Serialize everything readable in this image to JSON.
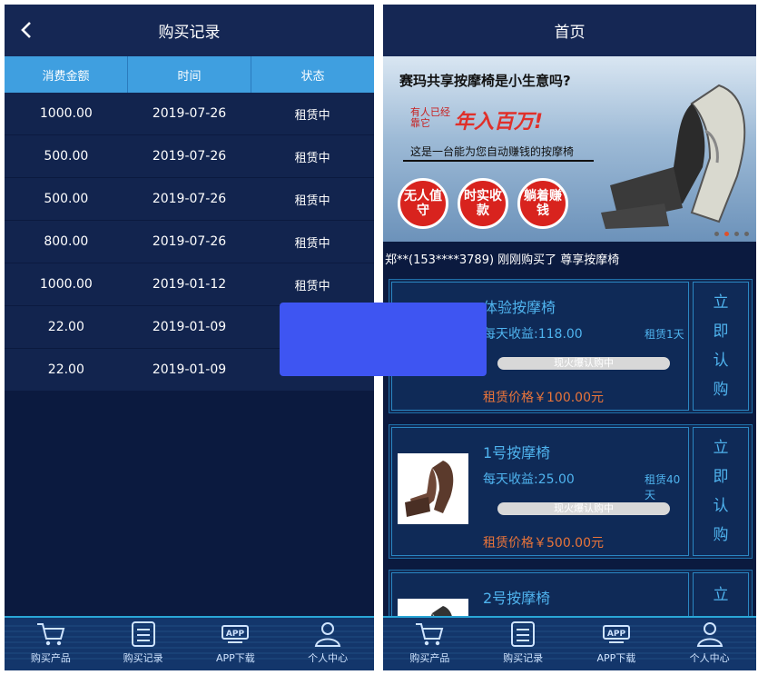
{
  "left": {
    "title": "购买记录",
    "columns": [
      "消费金额",
      "时间",
      "状态"
    ],
    "rows": [
      {
        "amount": "1000.00",
        "date": "2019-07-26",
        "status": "租赁中"
      },
      {
        "amount": "500.00",
        "date": "2019-07-26",
        "status": "租赁中"
      },
      {
        "amount": "500.00",
        "date": "2019-07-26",
        "status": "租赁中"
      },
      {
        "amount": "800.00",
        "date": "2019-07-26",
        "status": "租赁中"
      },
      {
        "amount": "1000.00",
        "date": "2019-01-12",
        "status": "租赁中"
      },
      {
        "amount": "22.00",
        "date": "2019-01-09",
        "status": ""
      },
      {
        "amount": "22.00",
        "date": "2019-01-09",
        "status": ""
      }
    ]
  },
  "right": {
    "title": "首页",
    "banner": {
      "headline": "赛玛共享按摩椅是小生意吗?",
      "red_small": "有人已经靠它",
      "red_big": "年入百万!",
      "sub": "这是一台能为您自动赚钱的按摩椅",
      "badges": [
        "无人值守",
        "时实收款",
        "躺着赚钱"
      ]
    },
    "notice": "郑**(153****3789) 刚刚购买了 尊享按摩椅",
    "products": [
      {
        "name": "体验按摩椅",
        "income": "每天收益:118.00",
        "days": "租赁1天",
        "bar": "现火爆认购中",
        "price": "租赁价格￥100.00元",
        "buy": [
          "立",
          "即",
          "认",
          "购"
        ]
      },
      {
        "name": "1号按摩椅",
        "income": "每天收益:25.00",
        "days": "租赁40天",
        "bar": "现火爆认购中",
        "price": "租赁价格￥500.00元",
        "buy": [
          "立",
          "即",
          "认",
          "购"
        ]
      },
      {
        "name": "2号按摩椅",
        "income": "",
        "days": "",
        "bar": "",
        "price": "",
        "buy": [
          "立"
        ]
      }
    ]
  },
  "tabs": [
    {
      "label": "购买产品",
      "icon": "cart-icon"
    },
    {
      "label": "购买记录",
      "icon": "list-icon"
    },
    {
      "label": "APP下载",
      "icon": "app-icon"
    },
    {
      "label": "个人中心",
      "icon": "user-icon"
    }
  ],
  "colors": {
    "bg": "#0b1a3f",
    "header": "#152754",
    "table_head": "#3f9fe0",
    "accent": "#4fb3ee",
    "price": "#e9743a",
    "overlay": "#3e55f2"
  }
}
